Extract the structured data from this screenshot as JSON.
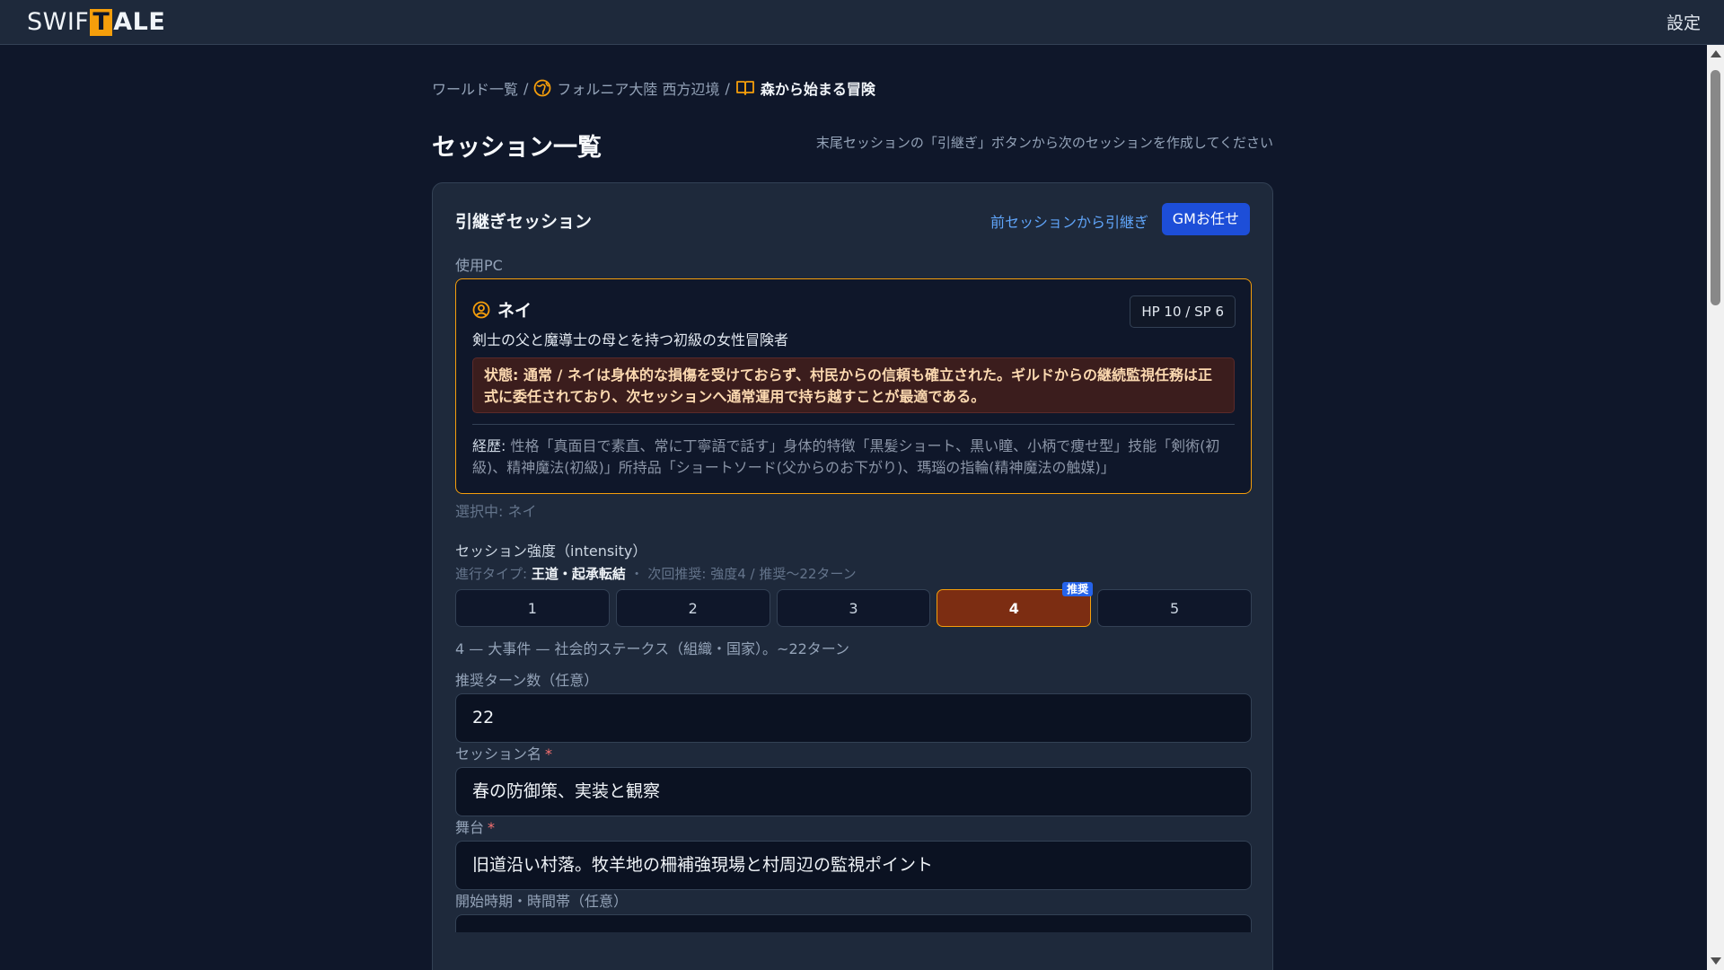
{
  "header": {
    "logo_pre": "SWIF",
    "logo_box": "T",
    "logo_post": "ALE",
    "settings_label": "設定"
  },
  "breadcrumb": {
    "items": [
      {
        "label": "ワールド一覧",
        "icon": ""
      },
      {
        "label": "フォルニア大陸 西方辺境",
        "icon": "world-icon"
      },
      {
        "label": "森から始まる冒険",
        "icon": "book-icon"
      }
    ],
    "separator": "/"
  },
  "page": {
    "title": "セッション一覧",
    "hint": "末尾セッションの「引継ぎ」ボタンから次のセッションを作成してください"
  },
  "card": {
    "title": "引継ぎセッション",
    "inherit_link": "前セッションから引継ぎ",
    "gm_button": "GMお任せ",
    "pc_label": "使用PC",
    "pc": {
      "name": "ネイ",
      "hp_sp": "HP 10 / SP 6",
      "description": "剣士の父と魔導士の母とを持つ初級の女性冒険者",
      "status": "状態: 通常 / ネイは身体的な損傷を受けておらず、村民からの信頼も確立された。ギルドからの継続監視任務は正式に委任されており、次セッションへ通常運用で持ち越すことが最適である。",
      "history_label": "経歴:",
      "history": " 性格「真面目で素直、常に丁寧語で話す」身体的特徴「黒髪ショート、黒い瞳、小柄で痩せ型」技能「剣術(初級)、精神魔法(初級)」所持品「ショートソード(父からのお下がり)、瑪瑙の指輪(精神魔法の触媒)」"
    },
    "selected": "選択中: ネイ",
    "intensity": {
      "label": "セッション強度（intensity）",
      "sub_prefix": "進行タイプ: ",
      "sub_type": "王道・起承転結",
      "sub_suffix": " ・ 次回推奨: 強度4 / 推奨〜22ターン",
      "options": [
        "1",
        "2",
        "3",
        "4",
        "5"
      ],
      "selected": "4",
      "recommended_badge": "推奨",
      "description": "4 — 大事件 — 社会的ステークス（組織・国家）。~22ターン"
    },
    "turns": {
      "label": "推奨ターン数（任意）",
      "value": "22"
    },
    "session_name": {
      "label": "セッション名",
      "required": "*",
      "value": "春の防御策、実装と観察"
    },
    "stage": {
      "label": "舞台",
      "required": "*",
      "value": "旧道沿い村落。牧羊地の柵補強現場と村周辺の監視ポイント"
    },
    "start_time": {
      "label": "開始時期・時間帯（任意）",
      "value": ""
    }
  }
}
